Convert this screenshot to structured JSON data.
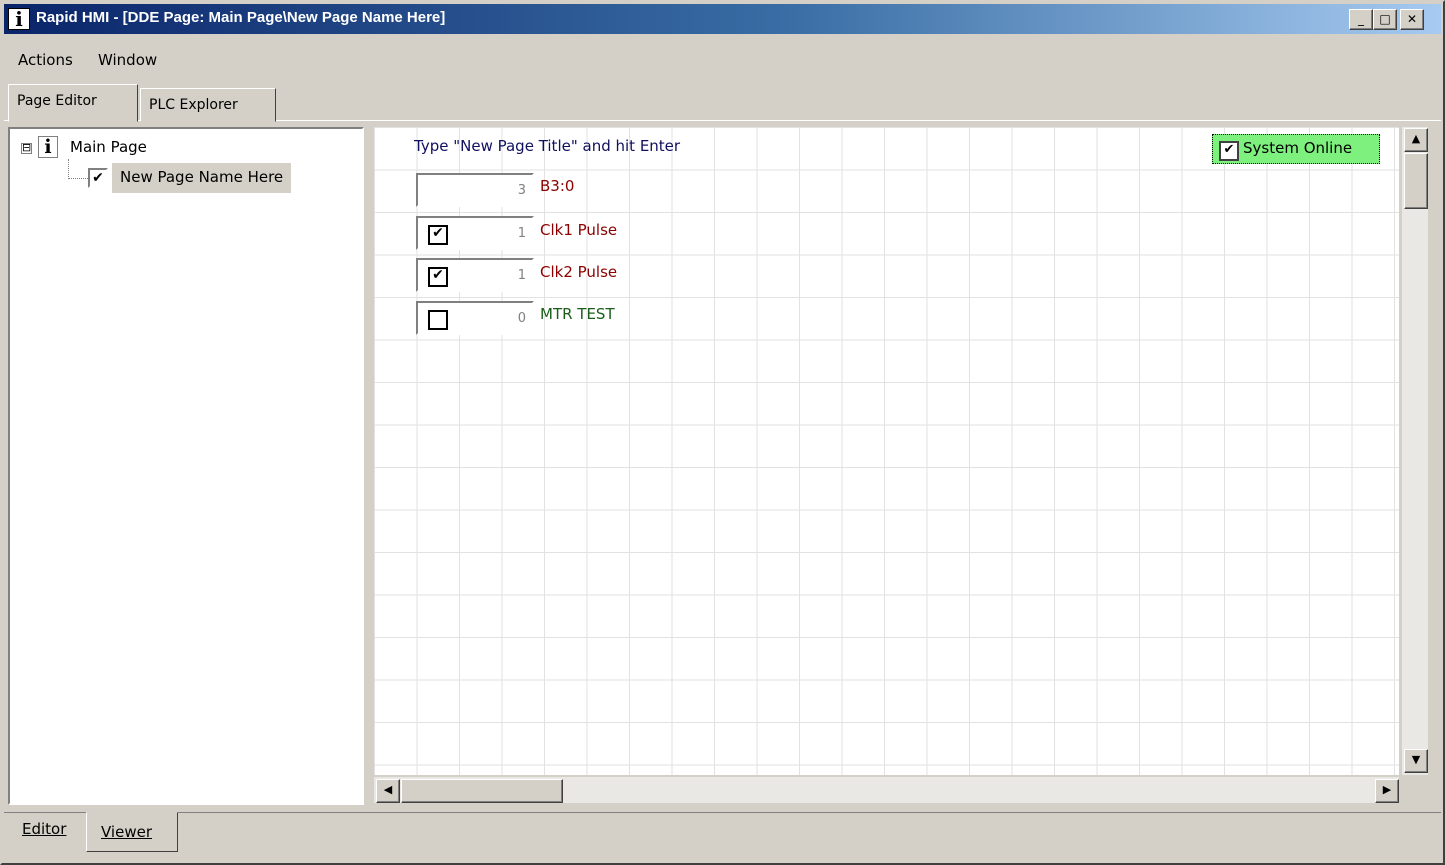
{
  "window": {
    "title": "Rapid HMI - [DDE Page: Main Page\\New Page Name Here]",
    "app_icon_glyph": "i",
    "controls": {
      "minimize": "_",
      "maximize": "□",
      "close": "✕"
    },
    "title_gradient": [
      "#0a246a",
      "#a6caf0"
    ]
  },
  "menu": {
    "items": [
      "Actions",
      "Window"
    ]
  },
  "top_tabs": [
    "Page Editor",
    "PLC Explorer"
  ],
  "tree": {
    "root": {
      "expander": "⊟",
      "icon": "i",
      "label": "Main Page"
    },
    "child": {
      "checked": "✔",
      "label": "New Page Name Here"
    }
  },
  "canvas": {
    "hint": "Type \"New Page Title\" and hit Enter",
    "rows": [
      {
        "value": "3",
        "tag": "B3:0",
        "has_checkbox": false,
        "checked": "",
        "tag_color": "#8b0000"
      },
      {
        "value": "1",
        "tag": "Clk1 Pulse",
        "has_checkbox": true,
        "checked": "✔",
        "tag_color": "#8b0000"
      },
      {
        "value": "1",
        "tag": "Clk2 Pulse",
        "has_checkbox": true,
        "checked": "✔",
        "tag_color": "#8b0000"
      },
      {
        "value": "0",
        "tag": "MTR TEST",
        "has_checkbox": true,
        "checked": "",
        "tag_color": "#1a5e1a"
      }
    ],
    "system_online": {
      "label": "System Online",
      "checked": "✔",
      "color": "#7df07d"
    }
  },
  "scroll": {
    "up": "▲",
    "down": "▼",
    "left": "◀",
    "right": "▶"
  },
  "bottom_tabs": {
    "editor": "Editor",
    "viewer": "Viewer"
  }
}
